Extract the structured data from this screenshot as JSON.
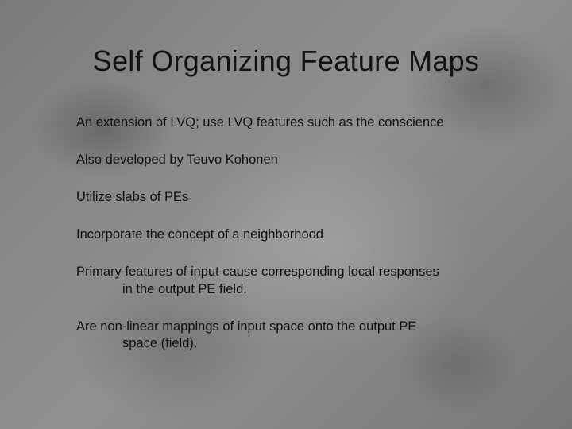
{
  "slide": {
    "title": "Self Organizing Feature Maps",
    "bullets": [
      {
        "line1": "An extension of LVQ; use LVQ features such as the conscience",
        "line2": ""
      },
      {
        "line1": "Also developed by Teuvo Kohonen",
        "line2": ""
      },
      {
        "line1": "Utilize slabs of PEs",
        "line2": ""
      },
      {
        "line1": "Incorporate the concept of a neighborhood",
        "line2": ""
      },
      {
        "line1": "Primary features of input cause corresponding local responses",
        "line2": "in the output PE field."
      },
      {
        "line1": "Are non-linear mappings of input space onto the output PE",
        "line2": "space (field)."
      }
    ]
  }
}
